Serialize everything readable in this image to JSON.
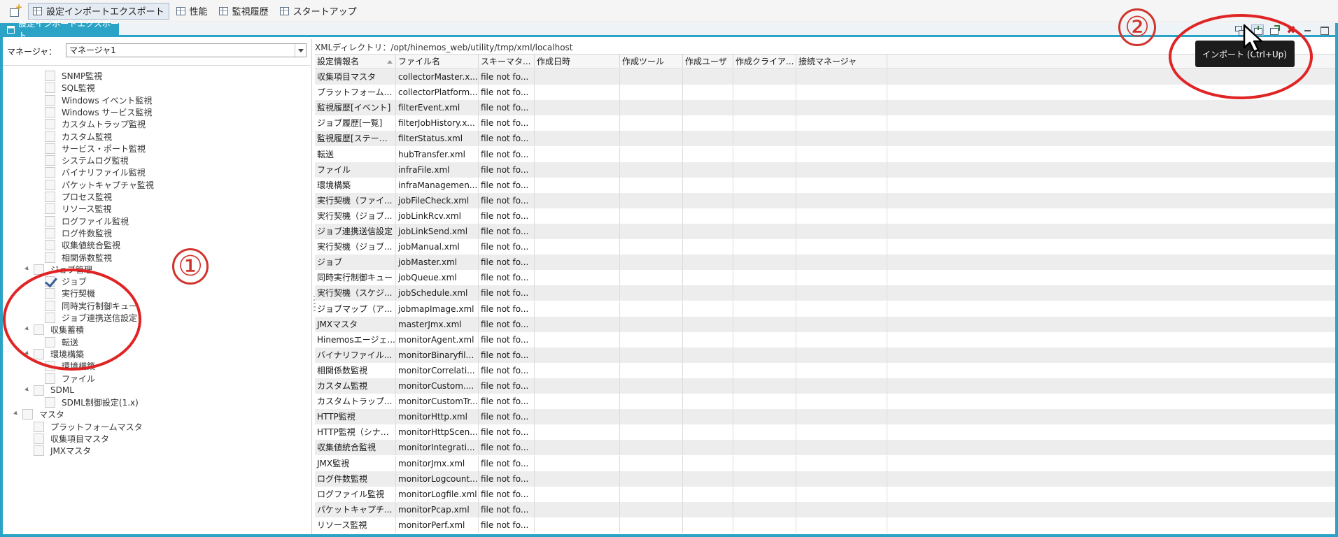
{
  "perspectives": [
    {
      "label": "設定インポートエクスポート",
      "active": true
    },
    {
      "label": "性能",
      "active": false
    },
    {
      "label": "監視履歴",
      "active": false
    },
    {
      "label": "スタートアップ",
      "active": false
    }
  ],
  "view": {
    "title": "設定インポートエクスポート",
    "tooltip": "インポート (Ctrl+Up)"
  },
  "manager": {
    "label": "マネージャ：",
    "value": "マネージャ1"
  },
  "tree": [
    {
      "label": "SNMP監視",
      "level": 2,
      "checked": false,
      "expander": false
    },
    {
      "label": "SQL監視",
      "level": 2,
      "checked": false,
      "expander": false
    },
    {
      "label": "Windows イベント監視",
      "level": 2,
      "checked": false,
      "expander": false
    },
    {
      "label": "Windows サービス監視",
      "level": 2,
      "checked": false,
      "expander": false
    },
    {
      "label": "カスタムトラップ監視",
      "level": 2,
      "checked": false,
      "expander": false
    },
    {
      "label": "カスタム監視",
      "level": 2,
      "checked": false,
      "expander": false
    },
    {
      "label": "サービス・ポート監視",
      "level": 2,
      "checked": false,
      "expander": false
    },
    {
      "label": "システムログ監視",
      "level": 2,
      "checked": false,
      "expander": false
    },
    {
      "label": "バイナリファイル監視",
      "level": 2,
      "checked": false,
      "expander": false
    },
    {
      "label": "パケットキャプチャ監視",
      "level": 2,
      "checked": false,
      "expander": false
    },
    {
      "label": "プロセス監視",
      "level": 2,
      "checked": false,
      "expander": false
    },
    {
      "label": "リソース監視",
      "level": 2,
      "checked": false,
      "expander": false
    },
    {
      "label": "ログファイル監視",
      "level": 2,
      "checked": false,
      "expander": false
    },
    {
      "label": "ログ件数監視",
      "level": 2,
      "checked": false,
      "expander": false
    },
    {
      "label": "収集値統合監視",
      "level": 2,
      "checked": false,
      "expander": false
    },
    {
      "label": "相関係数監視",
      "level": 2,
      "checked": false,
      "expander": false
    },
    {
      "label": "ジョブ管理",
      "level": 1,
      "checked": false,
      "expander": true
    },
    {
      "label": "ジョブ",
      "level": 2,
      "checked": true,
      "expander": false
    },
    {
      "label": "実行契機",
      "level": 2,
      "checked": false,
      "expander": false
    },
    {
      "label": "同時実行制御キュー",
      "level": 2,
      "checked": false,
      "expander": false
    },
    {
      "label": "ジョブ連携送信設定",
      "level": 2,
      "checked": false,
      "expander": false
    },
    {
      "label": "収集蓄積",
      "level": 1,
      "checked": false,
      "expander": true
    },
    {
      "label": "転送",
      "level": 2,
      "checked": false,
      "expander": false
    },
    {
      "label": "環境構築",
      "level": 1,
      "checked": false,
      "expander": true
    },
    {
      "label": "環境構築",
      "level": 2,
      "checked": false,
      "expander": false
    },
    {
      "label": "ファイル",
      "level": 2,
      "checked": false,
      "expander": false
    },
    {
      "label": "SDML",
      "level": 1,
      "checked": false,
      "expander": true
    },
    {
      "label": "SDML制御設定(1.x)",
      "level": 2,
      "checked": false,
      "expander": false
    },
    {
      "label": "マスタ",
      "level": 0,
      "checked": false,
      "expander": true
    },
    {
      "label": "プラットフォームマスタ",
      "level": 1,
      "checked": false,
      "expander": false
    },
    {
      "label": "収集項目マスタ",
      "level": 1,
      "checked": false,
      "expander": false
    },
    {
      "label": "JMXマスタ",
      "level": 1,
      "checked": false,
      "expander": false
    }
  ],
  "xml_dir": "XMLディレクトリ：/opt/hinemos_web/utility/tmp/xml/localhost",
  "table": {
    "headers": [
      "設定情報名",
      "ファイル名",
      "スキーマタ...",
      "作成日時",
      "作成ツール",
      "作成ユーザ",
      "作成クライア...",
      "接続マネージャ"
    ],
    "rows": [
      [
        "収集項目マスタ",
        "collectorMaster.x...",
        "file not fo..."
      ],
      [
        "プラットフォーム...",
        "collectorPlatform...",
        "file not fo..."
      ],
      [
        "監視履歴[イベント]",
        "filterEvent.xml",
        "file not fo..."
      ],
      [
        "ジョブ履歴[一覧]",
        "filterJobHistory.x...",
        "file not fo..."
      ],
      [
        "監視履歴[ステータ...",
        "filterStatus.xml",
        "file not fo..."
      ],
      [
        "転送",
        "hubTransfer.xml",
        "file not fo..."
      ],
      [
        "ファイル",
        "infraFile.xml",
        "file not fo..."
      ],
      [
        "環境構築",
        "infraManagemen...",
        "file not fo..."
      ],
      [
        "実行契機（ファイ...",
        "jobFileCheck.xml",
        "file not fo..."
      ],
      [
        "実行契機（ジョブ...",
        "jobLinkRcv.xml",
        "file not fo..."
      ],
      [
        "ジョブ連携送信設定",
        "jobLinkSend.xml",
        "file not fo..."
      ],
      [
        "実行契機（ジョブ...",
        "jobManual.xml",
        "file not fo..."
      ],
      [
        "ジョブ",
        "jobMaster.xml",
        "file not fo..."
      ],
      [
        "同時実行制御キュー",
        "jobQueue.xml",
        "file not fo..."
      ],
      [
        "実行契機（スケジ...",
        "jobSchedule.xml",
        "file not fo..."
      ],
      [
        "ジョブマップ（ア...",
        "jobmapImage.xml",
        "file not fo..."
      ],
      [
        "JMXマスタ",
        "masterJmx.xml",
        "file not fo..."
      ],
      [
        "Hinemosエージェ...",
        "monitorAgent.xml",
        "file not fo..."
      ],
      [
        "バイナリファイル...",
        "monitorBinaryfile...",
        "file not fo..."
      ],
      [
        "相関係数監視",
        "monitorCorrelati...",
        "file not fo..."
      ],
      [
        "カスタム監視",
        "monitorCustom....",
        "file not fo..."
      ],
      [
        "カスタムトラップ...",
        "monitorCustomTr...",
        "file not fo..."
      ],
      [
        "HTTP監視",
        "monitorHttp.xml",
        "file not fo..."
      ],
      [
        "HTTP監視（シナリ...",
        "monitorHttpScen...",
        "file not fo..."
      ],
      [
        "収集値統合監視",
        "monitorIntegrati...",
        "file not fo..."
      ],
      [
        "JMX監視",
        "monitorJmx.xml",
        "file not fo..."
      ],
      [
        "ログ件数監視",
        "monitorLogcount...",
        "file not fo..."
      ],
      [
        "ログファイル監視",
        "monitorLogfile.xml",
        "file not fo..."
      ],
      [
        "パケットキャプチ...",
        "monitorPcap.xml",
        "file not fo..."
      ],
      [
        "リソース監視",
        "monitorPerf.xml",
        "file not fo..."
      ]
    ]
  },
  "annotations": {
    "marker_1": "①",
    "marker_2": "②"
  },
  "colors": {
    "accent": "#2aa3c7",
    "annotation_red": "#e02424",
    "delete_red": "#cc1f1f"
  }
}
